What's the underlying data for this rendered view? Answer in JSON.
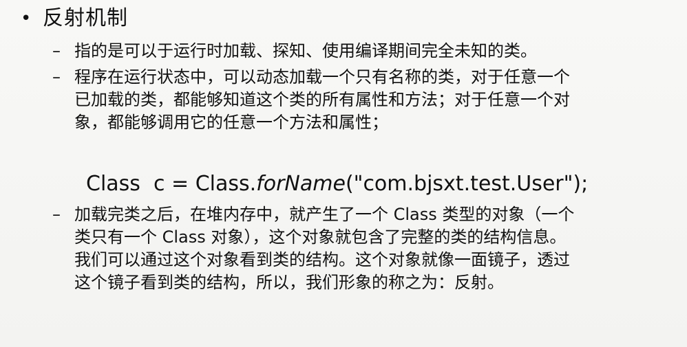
{
  "slide": {
    "heading": "反射机制",
    "bullets": [
      "指的是可以于运行时加载、探知、使用编译期间完全未知的类。",
      "程序在运行状态中，可以动态加载一个只有名称的类，对于任意一个\n已加载的类，都能够知道这个类的所有属性和方法；对于任意一个对\n象，都能够调用它的任意一个方法和属性；",
      "加载完类之后，在堆内存中，就产生了一个 Class 类型的对象（一个\n类只有一个 Class 对象），这个对象就包含了完整的类的结构信息。\n我们可以通过这个对象看到类的结构。这个对象就像一面镜子，透过\n这个镜子看到类的结构，所以，我们形象的称之为：反射。"
    ],
    "code": {
      "prefix": "Class  c = Class.",
      "method": "forName",
      "suffix": "(\"com.bjsxt.test.User\");"
    },
    "bullet_symbol": "•",
    "dash_symbol": "–"
  }
}
